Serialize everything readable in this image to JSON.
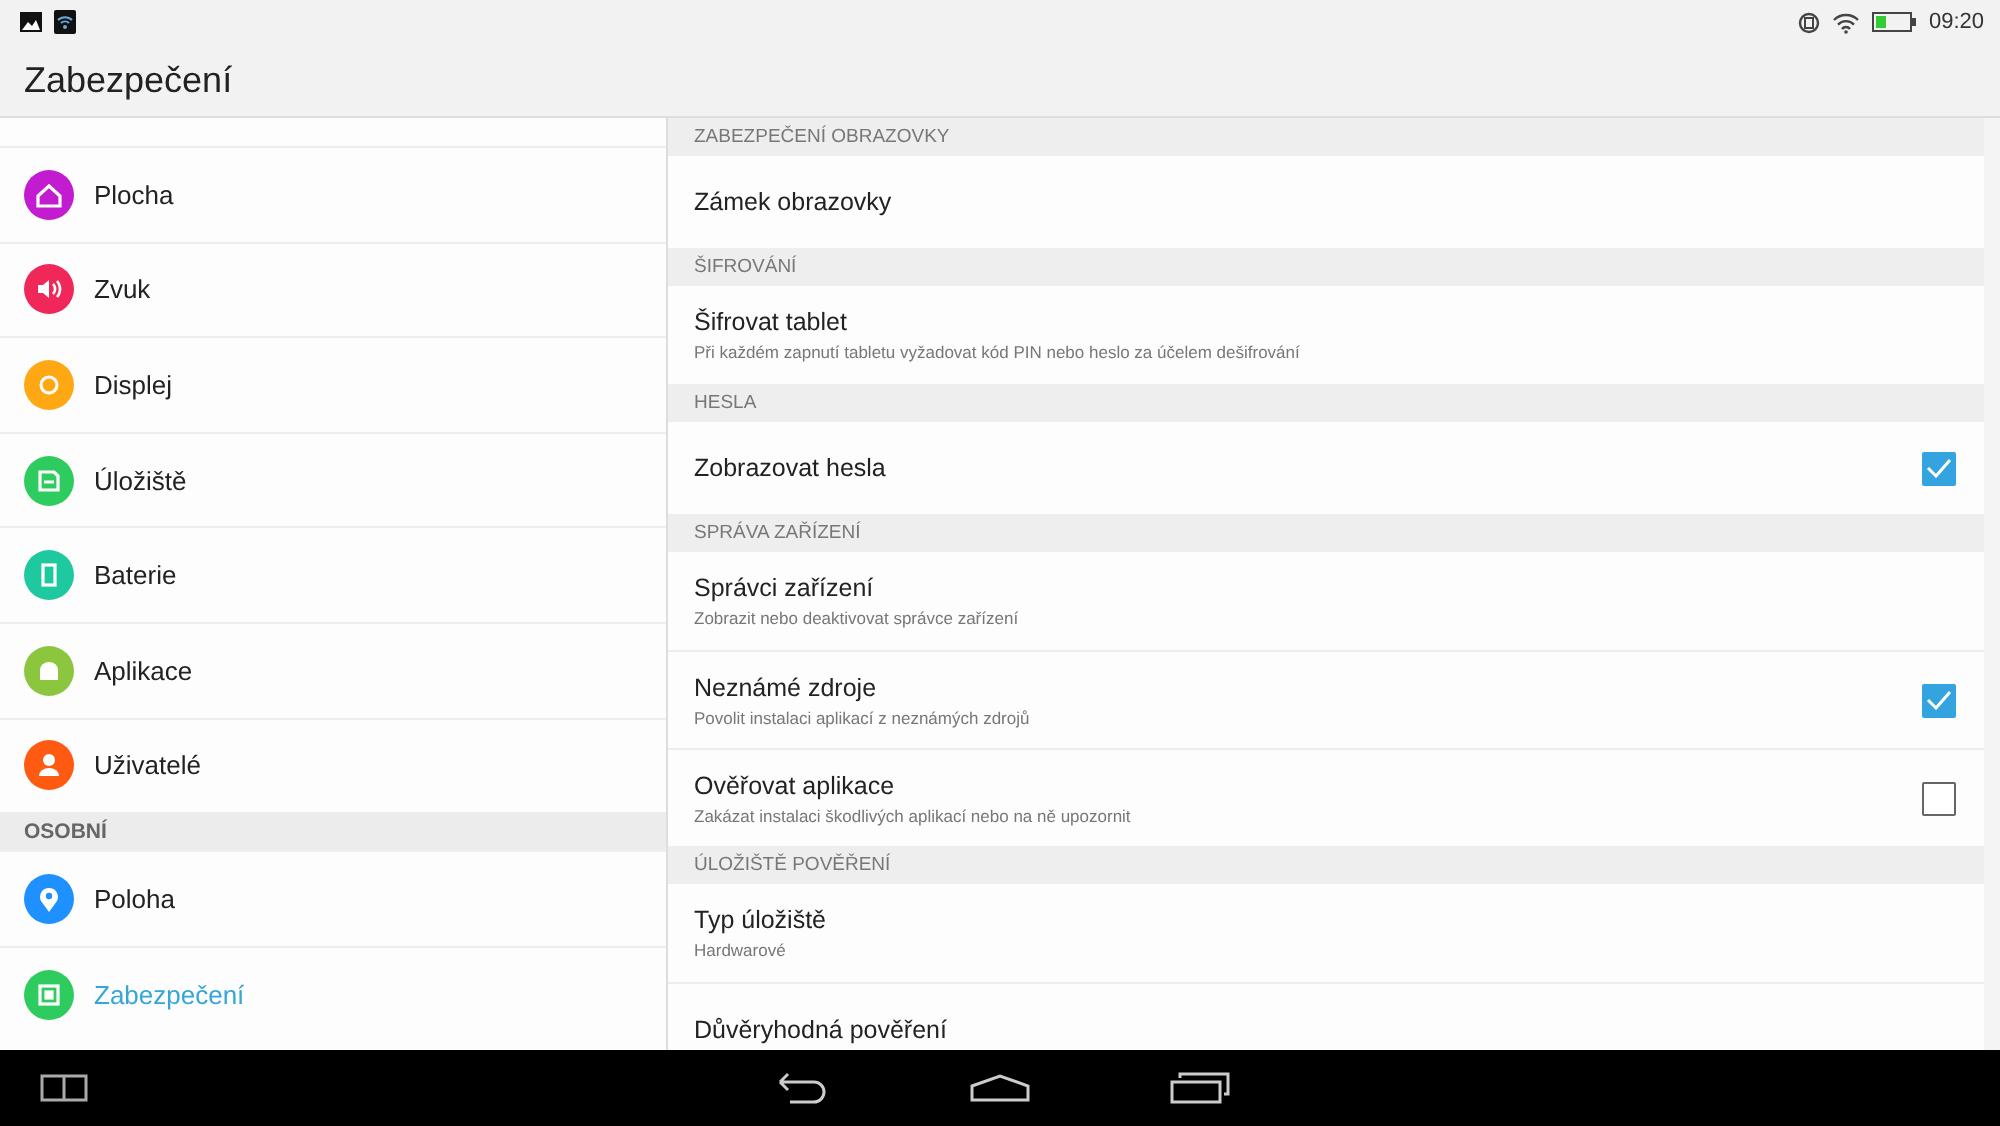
{
  "status_bar": {
    "time": "09:20"
  },
  "title": "Zabezpečení",
  "sidebar": {
    "items": [
      {
        "kind": "item",
        "label": "Plocha",
        "color": "#c21bd0",
        "selected": false
      },
      {
        "kind": "item",
        "label": "Zvuk",
        "color": "#f0285a",
        "selected": false
      },
      {
        "kind": "item",
        "label": "Displej",
        "color": "#ffa814",
        "selected": false
      },
      {
        "kind": "item",
        "label": "Úložiště",
        "color": "#2ecc5e",
        "selected": false
      },
      {
        "kind": "item",
        "label": "Baterie",
        "color": "#1fc9a0",
        "selected": false
      },
      {
        "kind": "item",
        "label": "Aplikace",
        "color": "#8cc63f",
        "selected": false
      },
      {
        "kind": "item",
        "label": "Uživatelé",
        "color": "#ff5a12",
        "selected": false
      },
      {
        "kind": "header",
        "label": "OSOBNÍ"
      },
      {
        "kind": "item",
        "label": "Poloha",
        "color": "#1e90ff",
        "selected": false
      },
      {
        "kind": "item",
        "label": "Zabezpečení",
        "color": "#2ecc5e",
        "selected": true
      }
    ]
  },
  "sections": [
    {
      "header": "ZABEZPEČENÍ OBRAZOVKY",
      "rows": [
        {
          "title": "Zámek obrazovky"
        }
      ]
    },
    {
      "header": "ŠIFROVÁNÍ",
      "rows": [
        {
          "title": "Šifrovat tablet",
          "summary": "Při každém zapnutí tabletu vyžadovat kód PIN nebo heslo za účelem dešifrování"
        }
      ]
    },
    {
      "header": "HESLA",
      "rows": [
        {
          "title": "Zobrazovat hesla",
          "checked": true
        }
      ]
    },
    {
      "header": "SPRÁVA ZAŘÍZENÍ",
      "rows": [
        {
          "title": "Správci zařízení",
          "summary": "Zobrazit nebo deaktivovat správce zařízení"
        },
        {
          "title": "Neznámé zdroje",
          "summary": "Povolit instalaci aplikací z neznámých zdrojů",
          "checked": true
        },
        {
          "title": "Ověřovat aplikace",
          "summary": "Zakázat instalaci škodlivých aplikací nebo na ně upozornit",
          "checked": false
        }
      ]
    },
    {
      "header": "ÚLOŽIŠTĚ POVĚŘENÍ",
      "rows": [
        {
          "title": "Typ úložiště",
          "summary": "Hardwarové"
        },
        {
          "title": "Důvěryhodná pověření"
        }
      ]
    }
  ]
}
